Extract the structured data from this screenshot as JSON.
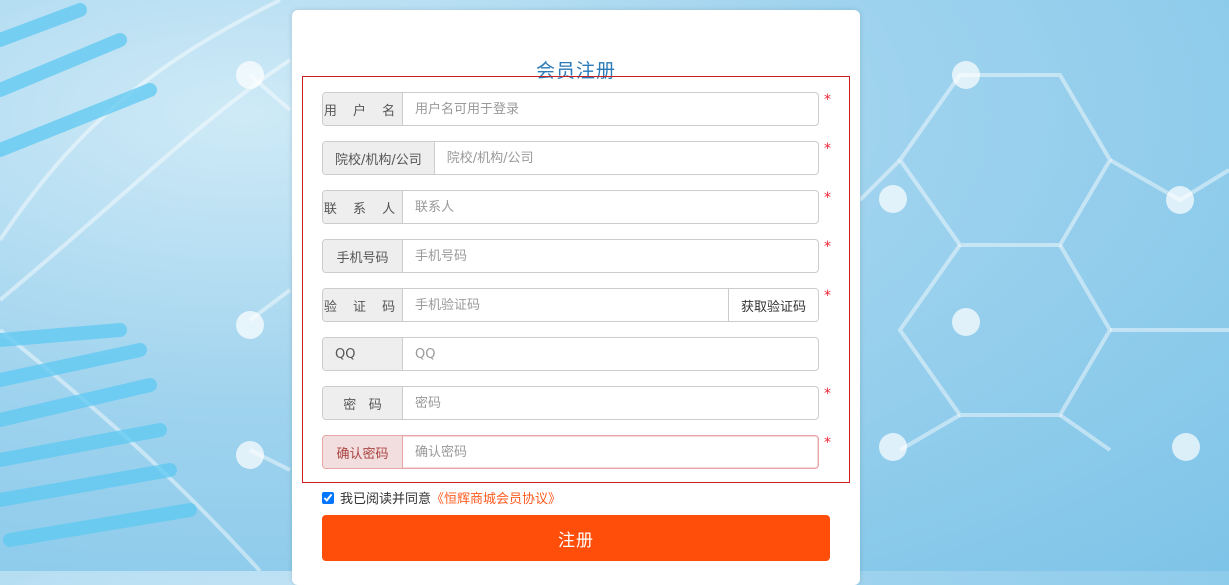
{
  "page": {
    "title": "会员注册",
    "accent": "#ff4d0a",
    "title_color": "#2a7ab8"
  },
  "fields": [
    {
      "label": "用 户 名",
      "placeholder": "用户名可用于登录",
      "required_mark": "*"
    },
    {
      "label": "院校/机构/公司",
      "placeholder": "院校/机构/公司",
      "required_mark": "*"
    },
    {
      "label": "联 系 人",
      "placeholder": "联系人",
      "required_mark": "*"
    },
    {
      "label": "手机号码",
      "placeholder": "手机号码",
      "required_mark": "*"
    },
    {
      "label": "验 证 码",
      "placeholder": "手机验证码",
      "required_mark": "*",
      "button": "获取验证码"
    },
    {
      "label": "QQ",
      "placeholder": "QQ"
    },
    {
      "label": "密   码",
      "placeholder": "密码",
      "required_mark": "*"
    },
    {
      "label": "确认密码",
      "placeholder": "确认密码",
      "required_mark": "*"
    }
  ],
  "agreement": {
    "text": "我已阅读并同意",
    "link": "《恒辉商城会员协议》",
    "checked": true
  },
  "submit_label": "注册"
}
